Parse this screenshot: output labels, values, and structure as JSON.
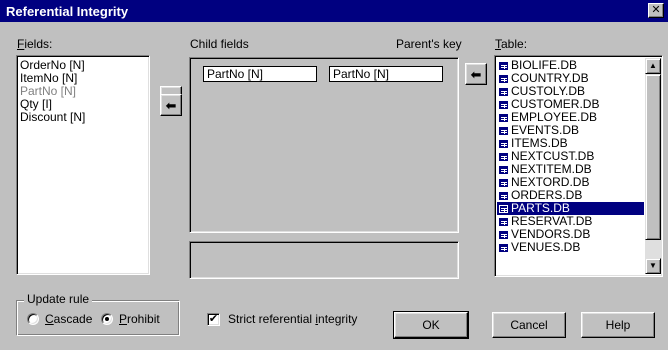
{
  "window": {
    "title": "Referential Integrity",
    "close_glyph": "✕"
  },
  "fields": {
    "label_hotkey": "F",
    "label_rest": "ields:",
    "items": [
      {
        "text": "OrderNo [N]",
        "disabled": false
      },
      {
        "text": "ItemNo [N]",
        "disabled": false
      },
      {
        "text": "PartNo [N]",
        "disabled": true
      },
      {
        "text": "Qty [I]",
        "disabled": false
      },
      {
        "text": "Discount [N]",
        "disabled": false
      }
    ]
  },
  "child_fields": {
    "label": "Child fields",
    "values": [
      "PartNo [N]"
    ]
  },
  "parents_key": {
    "label": "Parent's key",
    "values": [
      "PartNo [N]"
    ]
  },
  "table": {
    "label_hotkey": "T",
    "label_rest": "able:",
    "icon": "table-icon",
    "items": [
      {
        "text": "BIOLIFE.DB",
        "selected": false
      },
      {
        "text": "COUNTRY.DB",
        "selected": false
      },
      {
        "text": "CUSTOLY.DB",
        "selected": false
      },
      {
        "text": "CUSTOMER.DB",
        "selected": false
      },
      {
        "text": "EMPLOYEE.DB",
        "selected": false
      },
      {
        "text": "EVENTS.DB",
        "selected": false
      },
      {
        "text": "ITEMS.DB",
        "selected": false
      },
      {
        "text": "NEXTCUST.DB",
        "selected": false
      },
      {
        "text": "NEXTITEM.DB",
        "selected": false
      },
      {
        "text": "NEXTORD.DB",
        "selected": false
      },
      {
        "text": "ORDERS.DB",
        "selected": false
      },
      {
        "text": "PARTS.DB",
        "selected": true
      },
      {
        "text": "RESERVAT.DB",
        "selected": false
      },
      {
        "text": "VENDORS.DB",
        "selected": false
      },
      {
        "text": "VENUES.DB",
        "selected": false
      }
    ]
  },
  "arrows": {
    "add_field": "➡",
    "remove_field": "⬅",
    "remove_key": "⬅"
  },
  "update_rule": {
    "label": "Update rule",
    "cascade_hotkey": "C",
    "cascade_rest": "ascade",
    "prohibit_hotkey": "P",
    "prohibit_rest": "rohibit",
    "selected": "Prohibit"
  },
  "strict": {
    "pre": "Strict referential ",
    "hotkey": "i",
    "post": "ntegrity",
    "checked": true,
    "check_glyph": "✔"
  },
  "buttons": {
    "ok": "OK",
    "cancel": "Cancel",
    "help": "Help"
  }
}
